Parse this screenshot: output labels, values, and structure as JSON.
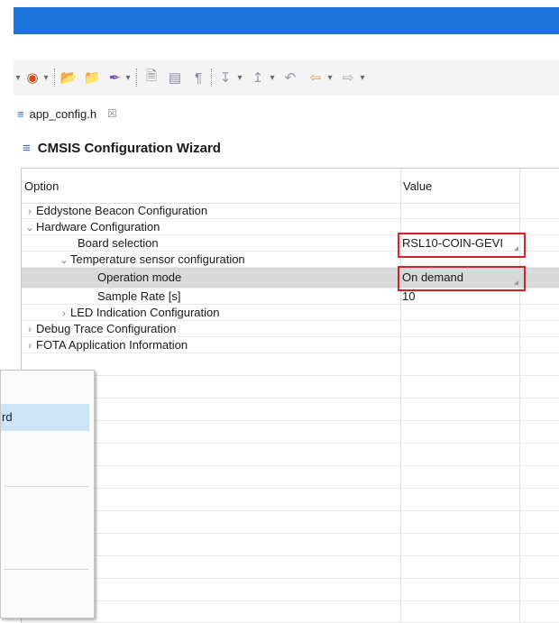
{
  "tab": {
    "label": "app_config.h",
    "close": "☒"
  },
  "panel": {
    "title": "CMSIS Configuration Wizard"
  },
  "columns": {
    "option": "Option",
    "value": "Value"
  },
  "rows": [
    {
      "label": "Eddystone Beacon Configuration",
      "toggle": ">",
      "value": ""
    },
    {
      "label": "Hardware Configuration",
      "toggle": "v",
      "value": ""
    },
    {
      "label": "Board selection",
      "toggle": "",
      "value": "RSL10-COIN-GEVI"
    },
    {
      "label": "Temperature sensor configuration",
      "toggle": "v",
      "value": ""
    },
    {
      "label": "Operation mode",
      "toggle": "",
      "value": "On demand"
    },
    {
      "label": "Sample Rate [s]",
      "toggle": "",
      "value": "10"
    },
    {
      "label": "LED Indication Configuration",
      "toggle": ">",
      "value": ""
    },
    {
      "label": "Debug Trace Configuration",
      "toggle": ">",
      "value": ""
    },
    {
      "label": "FOTA Application Information",
      "toggle": ">",
      "value": ""
    }
  ],
  "popup": {
    "highlighted_item": "rd"
  },
  "colors": {
    "titlebar": "#1e74d8",
    "highlight_box": "#d2232a",
    "selected_row": "#d9d9d9",
    "popup_highlight": "#cde4f7"
  }
}
